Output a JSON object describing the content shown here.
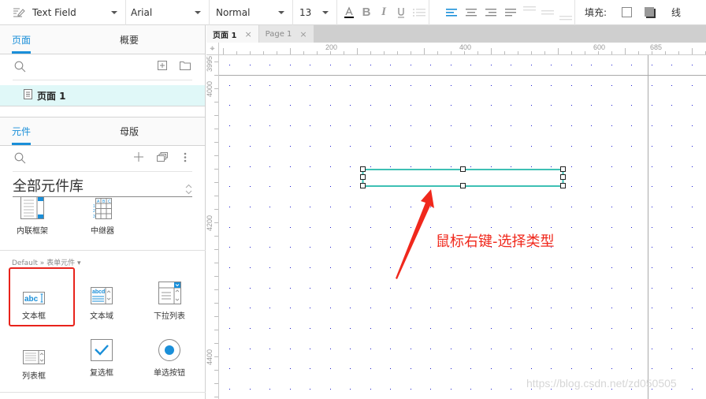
{
  "toolbar": {
    "widget_type": "Text Field",
    "font_family": "Arial",
    "font_style": "Normal",
    "font_size": "13",
    "fill_label": "填充:",
    "line_label": "线",
    "icons": [
      "text-color-icon",
      "bold-icon",
      "italic-icon",
      "underline-icon",
      "bullet-list-icon",
      "align-left-icon",
      "align-center-icon",
      "align-right-icon",
      "justify-icon",
      "valign-top-icon",
      "valign-middle-icon",
      "valign-bottom-icon",
      "fill-color-icon",
      "shadow-icon"
    ],
    "accent_color": "#1a8fd9"
  },
  "pages_panel": {
    "tabs": [
      "页面",
      "概要"
    ],
    "active_tab": "页面",
    "pages": [
      {
        "label": "页面 1",
        "selected": true
      }
    ]
  },
  "library_panel": {
    "tabs": [
      "元件",
      "母版"
    ],
    "active_tab": "元件",
    "library_name": "全部元件库",
    "top_widgets": [
      {
        "label": "内联框架",
        "icon": "inline-frame-icon"
      },
      {
        "label": "中继器",
        "icon": "repeater-icon"
      }
    ],
    "section_label": "Default » 表单元件 ▾",
    "form_widgets": [
      {
        "label": "文本框",
        "icon": "text-field-icon",
        "highlighted": true
      },
      {
        "label": "文本域",
        "icon": "text-area-icon"
      },
      {
        "label": "下拉列表",
        "icon": "droplist-icon"
      },
      {
        "label": "列表框",
        "icon": "list-box-icon"
      },
      {
        "label": "复选框",
        "icon": "checkbox-icon"
      },
      {
        "label": "单选按钮",
        "icon": "radio-button-icon"
      }
    ]
  },
  "document_tabs": [
    {
      "label": "页面 1",
      "active": true
    },
    {
      "label": "Page 1",
      "active": false
    }
  ],
  "rulers": {
    "horizontal_labels": [
      "200",
      "400",
      "600",
      "685"
    ],
    "vertical_labels": [
      "3995",
      "4000",
      "4200",
      "4400"
    ]
  },
  "annotation": {
    "text": "鼠标右键-选择类型",
    "color": "#f0281c"
  },
  "selection_color": "#3ec0b4",
  "watermark": "https://blog.csdn.net/zd050505"
}
